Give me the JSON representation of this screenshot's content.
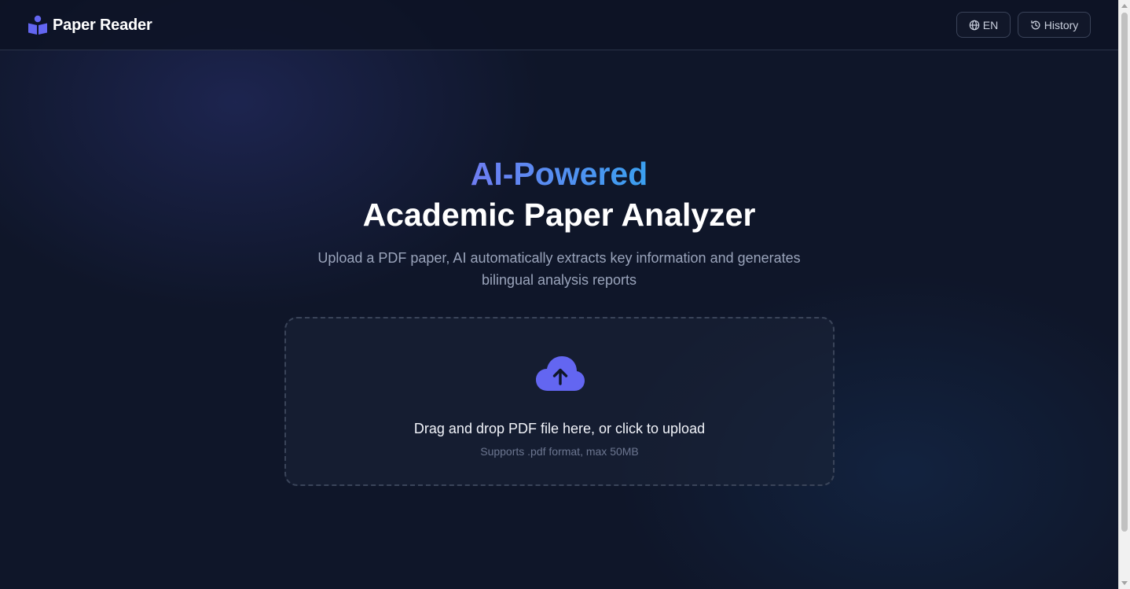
{
  "header": {
    "brand_name": "Paper Reader",
    "brand_icon": "reader-icon",
    "language_label": "EN",
    "language_icon": "globe-icon",
    "history_label": "History",
    "history_icon": "history-icon"
  },
  "hero": {
    "line1": "AI-Powered",
    "line2": "Academic Paper Analyzer",
    "subtitle": "Upload a PDF paper, AI automatically extracts key information and generates bilingual analysis reports"
  },
  "upload": {
    "icon": "cloud-upload-icon",
    "prompt": "Drag and drop PDF file here, or click to upload",
    "hint": "Supports .pdf format, max 50MB"
  },
  "colors": {
    "background": "#0f1629",
    "accent_start": "#6f7df2",
    "accent_end": "#3aa0f0",
    "upload_icon": "#6366f1"
  }
}
